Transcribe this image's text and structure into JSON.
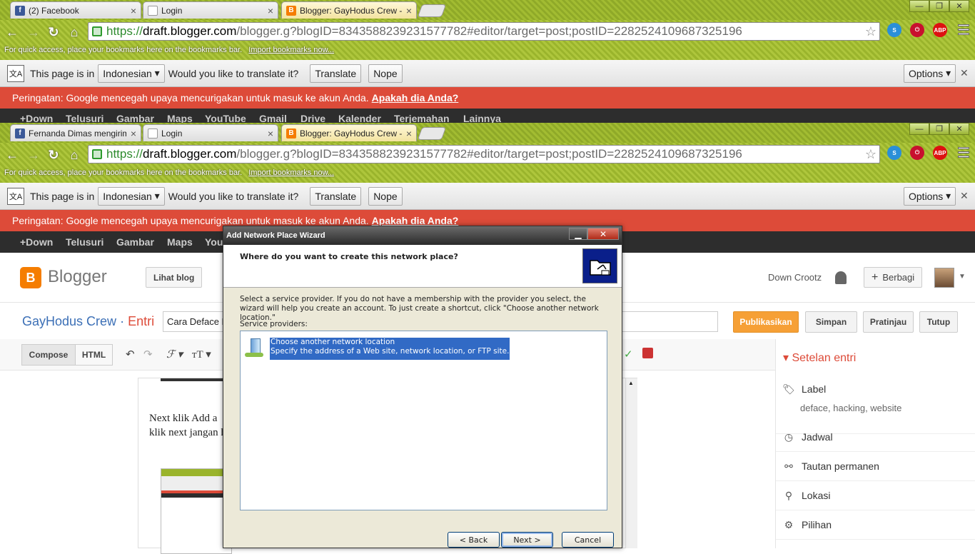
{
  "browser_back": {
    "tabs": [
      {
        "label": "(2) Facebook",
        "icon": "facebook-icon"
      },
      {
        "label": "Login",
        "icon": "page-icon"
      },
      {
        "label": "Blogger: GayHodus Crew - B...",
        "icon": "blogger-icon"
      }
    ]
  },
  "browser": {
    "tabs": [
      {
        "label": "Fernanda Dimas mengirimi an",
        "icon": "facebook-icon"
      },
      {
        "label": "Login",
        "icon": "page-icon"
      },
      {
        "label": "Blogger: GayHodus Crew - B...",
        "icon": "blogger-icon"
      }
    ],
    "url_scheme": "https://",
    "url_host": "draft.blogger.com",
    "url_path": "/blogger.g?blogID=8343588239231577782#editor/target=post;postID=2282524109687325196",
    "bookmarks_text": "For quick access, place your bookmarks here on the bookmarks bar.",
    "bookmarks_link": "Import bookmarks now...",
    "ext_abp": "ABP"
  },
  "translate": {
    "prefix": "This page is in",
    "language": "Indonesian",
    "question": "Would you like to translate it?",
    "translate_btn": "Translate",
    "nope_btn": "Nope",
    "options_btn": "Options"
  },
  "warning": {
    "text": "Peringatan: Google mencegah upaya mencurigakan untuk masuk ke akun Anda.",
    "link": "Apakah dia Anda?"
  },
  "gnav": [
    "+Down",
    "Telusuri",
    "Gambar",
    "Maps",
    "YouTube",
    "Gmail",
    "Drive",
    "Kalender",
    "Terjemahan",
    "Lainnya"
  ],
  "gnav_front": [
    "+Down",
    "Telusuri",
    "Gambar",
    "Maps",
    "You"
  ],
  "blogger": {
    "logo": "Blogger",
    "view_blog": "Lihat blog",
    "user": "Down Crootz",
    "share": "Berbagi",
    "blog_title": "GayHodus Crew",
    "sep": "·",
    "section": "Entri",
    "post_title": "Cara Deface D",
    "publish": "Publikasikan",
    "save": "Simpan",
    "preview": "Pratinjau",
    "close": "Tutup",
    "compose": "Compose",
    "html": "HTML",
    "editor_line1": "Next klik Add a",
    "editor_line2": "klik next jangan h",
    "sidebar_title": "Setelan entri",
    "label_title": "Label",
    "labels": "deface, hacking, website",
    "schedule": "Jadwal",
    "permalink": "Tautan permanen",
    "location": "Lokasi",
    "options": "Pilihan"
  },
  "dialog": {
    "title": "Add Network Place Wizard",
    "question": "Where do you want to create this network place?",
    "description": "Select a service provider.  If you do not have a membership with the provider you select, the wizard will help you create an account.  To just create a shortcut, click \"Choose another network location.\"",
    "providers_label": "Service providers:",
    "item_title": "Choose another network location",
    "item_desc": "Specify the address of a Web site, network location, or FTP site.",
    "back": "< Back",
    "next": "Next >",
    "cancel": "Cancel"
  }
}
